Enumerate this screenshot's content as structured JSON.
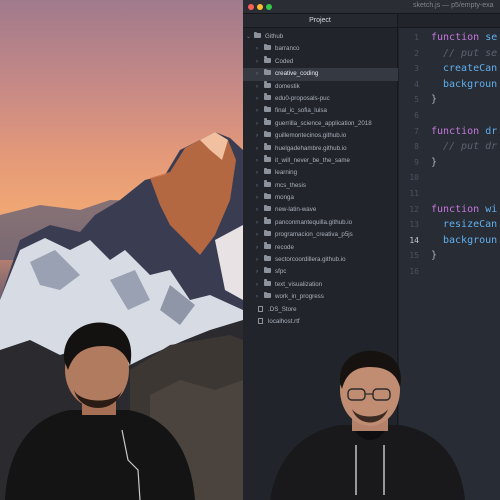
{
  "window": {
    "title": "sketch.js — p5/empty-exa"
  },
  "tree": {
    "header": "Project",
    "root": "Github",
    "items": [
      {
        "label": "barranco",
        "kind": "folder"
      },
      {
        "label": "Coded",
        "kind": "folder"
      },
      {
        "label": "creative_coding",
        "kind": "folder",
        "selected": true
      },
      {
        "label": "domestik",
        "kind": "folder"
      },
      {
        "label": "edu0-proposals-puc",
        "kind": "folder"
      },
      {
        "label": "final_ic_sofia_luisa",
        "kind": "folder"
      },
      {
        "label": "guerrilla_science_application_2018",
        "kind": "folder"
      },
      {
        "label": "guillemontecinos.github.io",
        "kind": "folder"
      },
      {
        "label": "huelgadehambre.github.io",
        "kind": "folder"
      },
      {
        "label": "it_will_never_be_the_same",
        "kind": "folder"
      },
      {
        "label": "learning",
        "kind": "folder"
      },
      {
        "label": "mcs_thesis",
        "kind": "folder"
      },
      {
        "label": "monga",
        "kind": "folder"
      },
      {
        "label": "new-latin-wave",
        "kind": "folder"
      },
      {
        "label": "panconmantequilla.github.io",
        "kind": "folder"
      },
      {
        "label": "programacion_creativa_p5js",
        "kind": "folder"
      },
      {
        "label": "recode",
        "kind": "folder"
      },
      {
        "label": "sectorcoordillera.github.io",
        "kind": "folder"
      },
      {
        "label": "sfpc",
        "kind": "folder"
      },
      {
        "label": "text_visualization",
        "kind": "folder"
      },
      {
        "label": "work_in_progress",
        "kind": "folder"
      },
      {
        "label": ".DS_Store",
        "kind": "file"
      },
      {
        "label": "localhost.rtf",
        "kind": "file"
      }
    ]
  },
  "editor": {
    "active_line": 14,
    "line_numbers": [
      "1",
      "2",
      "3",
      "4",
      "5",
      "6",
      "7",
      "8",
      "9",
      "10",
      "11",
      "12",
      "13",
      "14",
      "15",
      "16"
    ],
    "lines": [
      {
        "tokens": [
          {
            "t": "function ",
            "c": "kw"
          },
          {
            "t": "se",
            "c": "fn"
          }
        ]
      },
      {
        "indent": true,
        "tokens": [
          {
            "t": "// put se",
            "c": "cm"
          }
        ]
      },
      {
        "indent": true,
        "tokens": [
          {
            "t": "createCan",
            "c": "fn"
          }
        ]
      },
      {
        "indent": true,
        "tokens": [
          {
            "t": "backgroun",
            "c": "fn"
          }
        ]
      },
      {
        "tokens": [
          {
            "t": "}",
            "c": "pl"
          }
        ]
      },
      {
        "tokens": []
      },
      {
        "tokens": [
          {
            "t": "function ",
            "c": "kw"
          },
          {
            "t": "dr",
            "c": "fn"
          }
        ]
      },
      {
        "indent": true,
        "tokens": [
          {
            "t": "// put dr",
            "c": "cm"
          }
        ]
      },
      {
        "tokens": [
          {
            "t": "}",
            "c": "pl"
          }
        ]
      },
      {
        "tokens": []
      },
      {
        "tokens": []
      },
      {
        "tokens": [
          {
            "t": "function ",
            "c": "kw"
          },
          {
            "t": "wi",
            "c": "fn"
          }
        ]
      },
      {
        "indent": true,
        "tokens": [
          {
            "t": "resizeCan",
            "c": "fn"
          }
        ]
      },
      {
        "indent": true,
        "tokens": [
          {
            "t": "backgroun",
            "c": "fn"
          }
        ]
      },
      {
        "tokens": [
          {
            "t": "}",
            "c": "pl"
          }
        ]
      },
      {
        "tokens": []
      }
    ]
  },
  "colors": {
    "close": "#fc5f57",
    "minimize": "#fdbc2e",
    "maximize": "#34c84a",
    "keyword": "#c678dd",
    "function": "#61afef",
    "comment": "#5c6370"
  }
}
